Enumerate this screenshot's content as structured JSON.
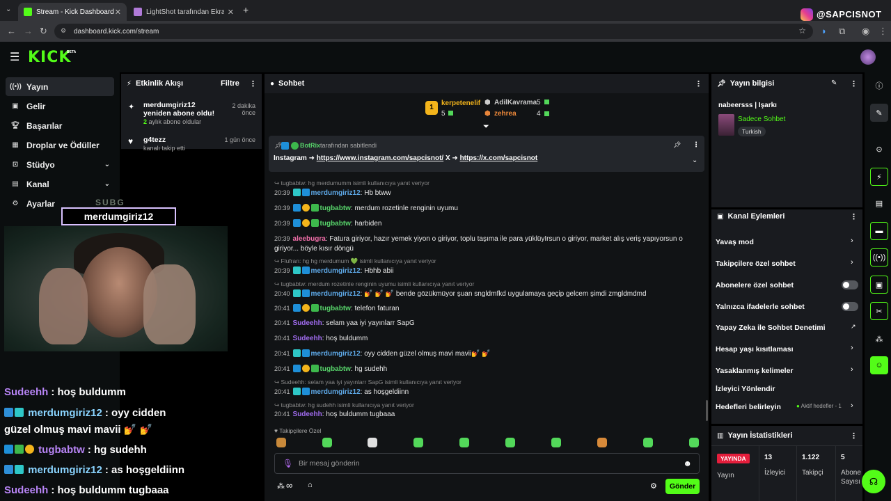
{
  "browser": {
    "tabs": [
      {
        "title": "Stream - Kick Dashboard",
        "active": true
      },
      {
        "title": "LightShot tarafından Ekran Gör",
        "active": false
      }
    ],
    "url": "dashboard.kick.com/stream",
    "watermark": "@SAPCISNOT"
  },
  "kick": {
    "logo": "KICK",
    "beta": "BETA"
  },
  "sidebar": {
    "items": [
      {
        "label": "Yayın",
        "icon": "broadcast-icon"
      },
      {
        "label": "Gelir",
        "icon": "wallet-icon"
      },
      {
        "label": "Başarılar",
        "icon": "trophy-icon"
      },
      {
        "label": "Droplar ve Ödüller",
        "icon": "gift-icon"
      },
      {
        "label": "Stüdyo",
        "icon": "studio-icon"
      },
      {
        "label": "Kanal",
        "icon": "channel-icon"
      },
      {
        "label": "Ayarlar",
        "icon": "gear-icon"
      }
    ]
  },
  "overlay": {
    "sub_tag": "SUBG",
    "sub_name": "merdumgiriz12",
    "lines": [
      {
        "user": "Sudeehh",
        "text": ": hoş buldumm"
      },
      {
        "user": "merdumgiriz12",
        "text": ": oyy cidden"
      },
      {
        "user": "",
        "text": "güzel olmuş mavi mavii 💅 💅"
      },
      {
        "user": "tugbabtw",
        "text": ": hg sudehh"
      },
      {
        "user": "merdumgiriz12",
        "text": ": as hoşgeldiinn"
      },
      {
        "user": "Sudeehh",
        "text": ": hoş buldumm tugbaaa"
      }
    ]
  },
  "activity": {
    "title": "Etkinlik Akışı",
    "filter": "Filtre",
    "events": [
      {
        "title": "merdumgiriz12 yeniden abone oldu!",
        "sub_count": "2",
        "sub_rest": "aylık abone oldular",
        "time1": "2 dakika",
        "time2": "önce"
      },
      {
        "title": "g4tezz",
        "sub": "kanalı takip etti",
        "time1": "1 gün önce"
      }
    ]
  },
  "chat": {
    "title": "Sohbet",
    "leaders": [
      {
        "name": "kerpetenelif",
        "count": "5"
      },
      {
        "name": "AdilKavrama",
        "count": "5"
      },
      {
        "name": "zehrea",
        "count": "4"
      }
    ],
    "pinned": {
      "by": "BotRix",
      "by_suffix": "tarafından sabitlendi",
      "prefix": "Instagram ➜ ",
      "link1": "https://www.instagram.com/sapcisnot/",
      "mid": " X ➜ ",
      "link2": "https://x.com/sapcisnot"
    },
    "messages": [
      {
        "kind": "reply",
        "text": "tugbabtw: hg merdumumm isimli kullanıcıya yanıt veriyor"
      },
      {
        "time": "20:39",
        "user": "merdumgiriz12",
        "text": ": Hb btww"
      },
      {
        "time": "20:39",
        "user": "tugbabtw",
        "text": ": merdum rozetinle renginin uyumu"
      },
      {
        "time": "20:39",
        "user": "tugbabtw",
        "text": ": harbiden"
      },
      {
        "time": "20:39",
        "user": "aleebugra",
        "text": ": Fatura giriyor, hazır yemek yiyon o giriyor, toplu taşıma ile para yüklüyIrsun o giriyor, market alış veriş yapıyorsun o giriyor... böyle"
      },
      {
        "kind": "cont",
        "text": "kısır döngü"
      },
      {
        "kind": "reply",
        "text": "Flufran: hg hg merdumum 💚 isimli kullanıcıya yanıt veriyor"
      },
      {
        "time": "20:39",
        "user": "merdumgiriz12",
        "text": ": Hbhb abii"
      },
      {
        "kind": "reply",
        "text": "tugbabtw: merdum rozetinle renginin uyumu isimli kullanıcıya yanıt veriyor"
      },
      {
        "time": "20:40",
        "user": "merdumgiriz12",
        "text": ": 💅 💅 💅  bende gözükmüyor şuan sngldmfkd uygulamaya geçip gelcem şimdi zmgldmdmd"
      },
      {
        "time": "20:41",
        "user": "tugbabtw",
        "text": ": telefon faturan"
      },
      {
        "time": "20:41",
        "user": "Sudeehh",
        "text": ":  selam yaa iyi yayınlarr SapG"
      },
      {
        "time": "20:41",
        "user": "Sudeehh",
        "text": ": hoş buldumm"
      },
      {
        "time": "20:41",
        "user": "merdumgiriz12",
        "text": ": oyy cidden güzel olmuş mavi mavii💅 💅"
      },
      {
        "time": "20:41",
        "user": "tugbabtw",
        "text": ": hg sudehh"
      },
      {
        "kind": "reply",
        "text": "Sudeehh:  selam yaa iyi yayınlarr SapG isimli kullanıcıya yanıt veriyor"
      },
      {
        "time": "20:41",
        "user": "merdumgiriz12",
        "text": ": as hoşgeldiinn"
      },
      {
        "kind": "reply",
        "text": "tugbabtw: hg sudehh isimli kullanıcıya yanıt veriyor"
      },
      {
        "time": "20:41",
        "user": "Sudeehh",
        "text": ": hoş buldumm tugbaaa"
      }
    ],
    "followers_only_label": "Takipçilere Özel",
    "input_placeholder": "Bir mesaj gönderin",
    "infinity": "∞",
    "send_label": "Gönder"
  },
  "stream_info": {
    "title": "Yayın bilgisi",
    "stream_title": "nabeersss | Işarkı",
    "category": "Sadece Sohbet",
    "tag": "Turkish"
  },
  "channel_actions": {
    "title": "Kanal Eylemleri",
    "items": [
      {
        "label": "Yavaş mod",
        "control": "chevron"
      },
      {
        "label": "Takipçilere özel sohbet",
        "control": "chevron"
      },
      {
        "label": "Abonelere özel sohbet",
        "control": "toggle"
      },
      {
        "label": "Yalnızca ifadelerle sohbet",
        "control": "toggle"
      },
      {
        "label": "Yapay Zeka ile Sohbet Denetimi",
        "control": "external"
      },
      {
        "label": "Hesap yaşı kısıtlaması",
        "control": "chevron"
      },
      {
        "label": "Yasaklanmış kelimeler",
        "control": "chevron"
      },
      {
        "label": "İzleyici Yönlendir",
        "control": "none"
      },
      {
        "label": "Hedefleri belirleyin",
        "control": "chevron",
        "status": "Aktif hedefler - 1"
      }
    ]
  },
  "stats": {
    "title": "Yayın İstatistikleri",
    "live_badge": "YAYINDA",
    "live_label": "Yayın",
    "viewers": "13",
    "viewers_label": "İzleyici",
    "followers": "1.122",
    "followers_label": "Takipçi",
    "subs": "5",
    "subs_label1": "Abone",
    "subs_label2": "Sayısı"
  },
  "colors": {
    "accent": "#53fc18",
    "panel": "#191b1f",
    "bg": "#0b0e0f"
  }
}
